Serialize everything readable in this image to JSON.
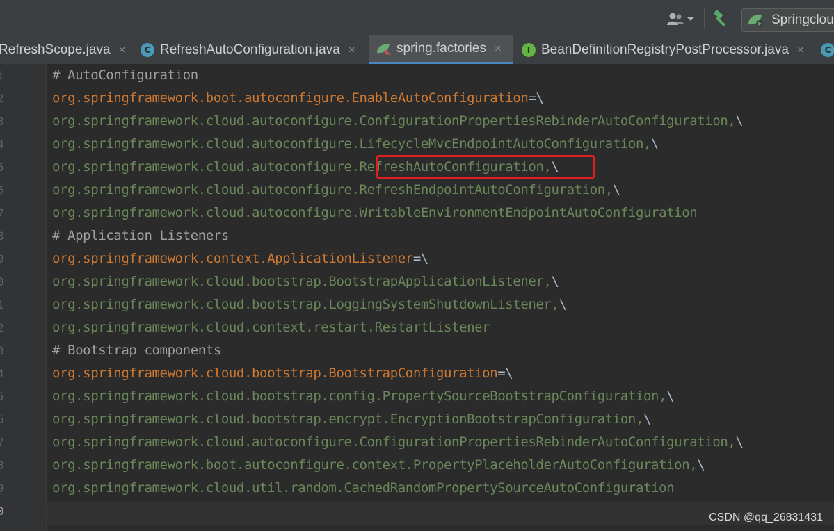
{
  "toolbar": {
    "run_config_label": "Springcloud",
    "icons": [
      "user-icon",
      "hammer-icon",
      "run-config-icon"
    ]
  },
  "tabs": [
    {
      "label": "RefreshScope.java",
      "icon": "",
      "active": false
    },
    {
      "label": "RefreshAutoConfiguration.java",
      "icon": "C",
      "active": false
    },
    {
      "label": "spring.factories",
      "icon": "spring-leaf",
      "active": true
    },
    {
      "label": "BeanDefinitionRegistryPostProcessor.java",
      "icon": "I",
      "active": false
    },
    {
      "label": "",
      "icon": "C",
      "active": false
    }
  ],
  "tab_close": "×",
  "gutter": {
    "line_numbers": [
      "1",
      "2",
      "3",
      "4",
      "5",
      "6",
      "7",
      "8",
      "9",
      "0",
      "1",
      "2",
      "3",
      "4",
      "5",
      "6",
      "7",
      "8",
      "9",
      "0"
    ]
  },
  "code": {
    "lines": [
      {
        "type": "comment",
        "text": "# AutoConfiguration"
      },
      {
        "type": "key",
        "text": "org.springframework.boot.autoconfigure.EnableAutoConfiguration",
        "suffix": "=\\"
      },
      {
        "type": "val",
        "text": "org.springframework.cloud.autoconfigure.ConfigurationPropertiesRebinderAutoConfiguration,",
        "suffix": "\\"
      },
      {
        "type": "val",
        "text": "org.springframework.cloud.autoconfigure.LifecycleMvcEndpointAutoConfiguration,",
        "suffix": "\\"
      },
      {
        "type": "val",
        "text": "org.springframework.cloud.autoconfigure.RefreshAutoConfiguration,",
        "suffix": "\\"
      },
      {
        "type": "val",
        "text": "org.springframework.cloud.autoconfigure.RefreshEndpointAutoConfiguration,",
        "suffix": "\\"
      },
      {
        "type": "val",
        "text": "org.springframework.cloud.autoconfigure.WritableEnvironmentEndpointAutoConfiguration",
        "suffix": ""
      },
      {
        "type": "comment",
        "text": "# Application Listeners"
      },
      {
        "type": "key",
        "text": "org.springframework.context.ApplicationListener",
        "suffix": "=\\"
      },
      {
        "type": "val",
        "text": "org.springframework.cloud.bootstrap.BootstrapApplicationListener,",
        "suffix": "\\"
      },
      {
        "type": "val",
        "text": "org.springframework.cloud.bootstrap.LoggingSystemShutdownListener,",
        "suffix": "\\"
      },
      {
        "type": "val",
        "text": "org.springframework.cloud.context.restart.RestartListener",
        "suffix": ""
      },
      {
        "type": "comment",
        "text": "# Bootstrap components"
      },
      {
        "type": "key",
        "text": "org.springframework.cloud.bootstrap.BootstrapConfiguration",
        "suffix": "=\\"
      },
      {
        "type": "val",
        "text": "org.springframework.cloud.bootstrap.config.PropertySourceBootstrapConfiguration,",
        "suffix": "\\"
      },
      {
        "type": "val",
        "text": "org.springframework.cloud.bootstrap.encrypt.EncryptionBootstrapConfiguration,",
        "suffix": "\\"
      },
      {
        "type": "val",
        "text": "org.springframework.cloud.autoconfigure.ConfigurationPropertiesRebinderAutoConfiguration,",
        "suffix": "\\"
      },
      {
        "type": "val",
        "text": "org.springframework.boot.autoconfigure.context.PropertyPlaceholderAutoConfiguration,",
        "suffix": "\\"
      },
      {
        "type": "val",
        "text": "org.springframework.cloud.util.random.CachedRandomPropertySourceAutoConfiguration",
        "suffix": ""
      },
      {
        "type": "val",
        "text": "",
        "suffix": ""
      }
    ],
    "highlighted_text": "RefreshAutoConfiguration,"
  },
  "watermark": "CSDN @qq_26831431",
  "colors": {
    "background": "#2b2b2b",
    "key": "#cc7832",
    "value": "#6a8759",
    "comment": "#a0a0a0",
    "highlight": "#e02020"
  }
}
